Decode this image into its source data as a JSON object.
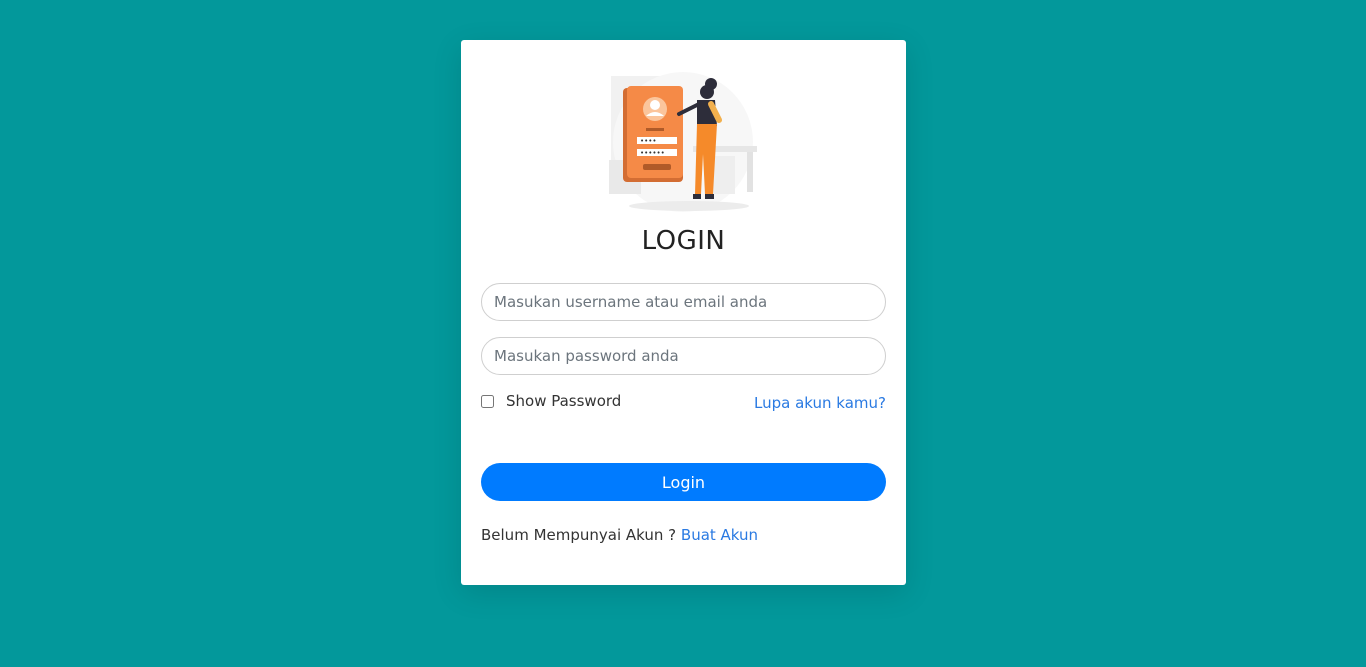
{
  "login": {
    "title": "LOGIN",
    "username_placeholder": "Masukan username atau email anda",
    "password_placeholder": "Masukan password anda",
    "show_password_label": "Show Password",
    "forgot_link": "Lupa akun kamu?",
    "submit_label": "Login",
    "register_prompt": "Belum Mempunyai Akun ?",
    "register_link": "Buat Akun"
  },
  "colors": {
    "background": "#03989b",
    "card": "#ffffff",
    "primary_button": "#007bff",
    "link": "#2a7ae2",
    "illustration_accent": "#f58a47"
  },
  "illustration": {
    "icon": "login-illustration",
    "password_dots_1": "••••",
    "password_dots_2": "••••••"
  }
}
